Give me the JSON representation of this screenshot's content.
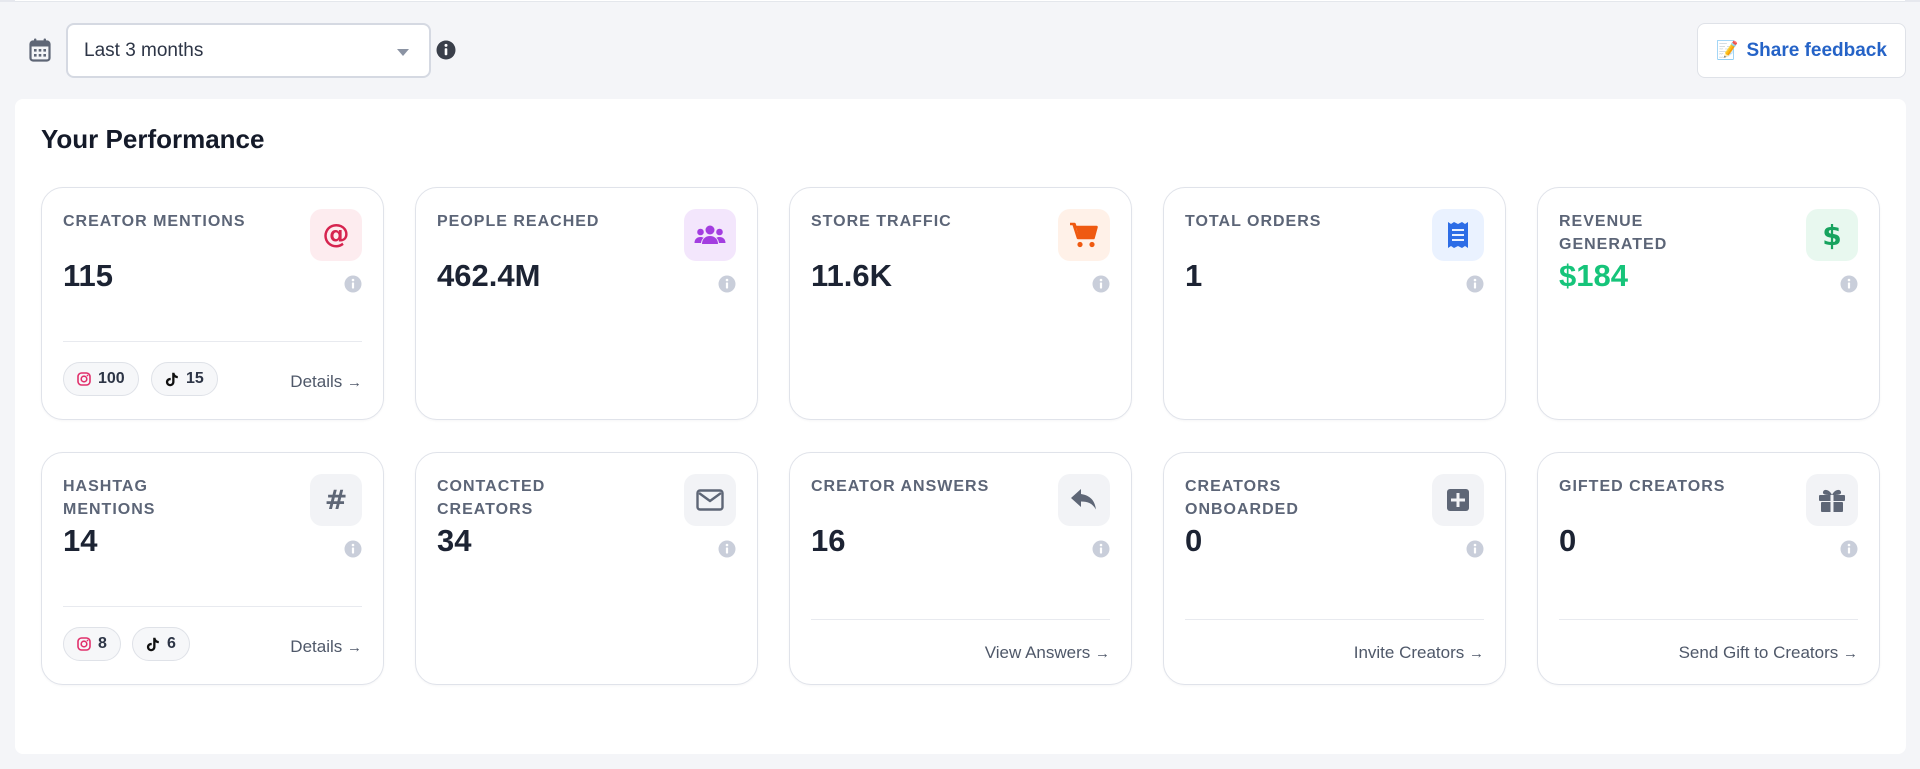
{
  "toolbar": {
    "date_range": "Last 3 months",
    "share_feedback": "Share feedback",
    "calendar_icon": "calendar-icon",
    "info_icon": "info-icon"
  },
  "panel": {
    "title": "Your Performance"
  },
  "cards": [
    {
      "label": "Creator Mentions",
      "value": "115",
      "icon": "at-sign-icon",
      "icon_color": "#d6244f",
      "icon_bg": "#fdecef",
      "instagram_count": "100",
      "tiktok_count": "15",
      "details": "Details"
    },
    {
      "label": "People Reached",
      "value": "462.4M",
      "icon": "users-icon",
      "icon_color": "#a33de0",
      "icon_bg": "#f3e6fc"
    },
    {
      "label": "Store Traffic",
      "value": "11.6K",
      "icon": "shopping-cart-icon",
      "icon_color": "#ef5a11",
      "icon_bg": "#fff1e8"
    },
    {
      "label": "Total Orders",
      "value": "1",
      "icon": "receipt-icon",
      "icon_color": "#2d6de6",
      "icon_bg": "#eaf2ff"
    },
    {
      "label": "Revenue Generated",
      "value": "$184",
      "icon": "dollar-icon",
      "icon_color": "#17a35e",
      "icon_bg": "#e8f8ef",
      "value_color": "#16c47a"
    },
    {
      "label": "Hashtag Mentions",
      "value": "14",
      "icon": "hashtag-icon",
      "icon_color": "#5e6676",
      "icon_bg": "#f2f3f6",
      "instagram_count": "8",
      "tiktok_count": "6",
      "details": "Details"
    },
    {
      "label": "Contacted Creators",
      "value": "34",
      "icon": "envelope-icon",
      "icon_color": "#5e6676",
      "icon_bg": "#f2f3f6"
    },
    {
      "label": "Creator Answers",
      "value": "16",
      "icon": "reply-icon",
      "icon_color": "#5e6676",
      "icon_bg": "#f2f3f6",
      "link": "View Answers"
    },
    {
      "label": "Creators Onboarded",
      "value": "0",
      "icon": "plus-square-icon",
      "icon_color": "#5e6676",
      "icon_bg": "#f2f3f6",
      "link": "Invite Creators"
    },
    {
      "label": "Gifted Creators",
      "value": "0",
      "icon": "gift-icon",
      "icon_color": "#5e6676",
      "icon_bg": "#f2f3f6",
      "link": "Send Gift to Creators"
    }
  ]
}
